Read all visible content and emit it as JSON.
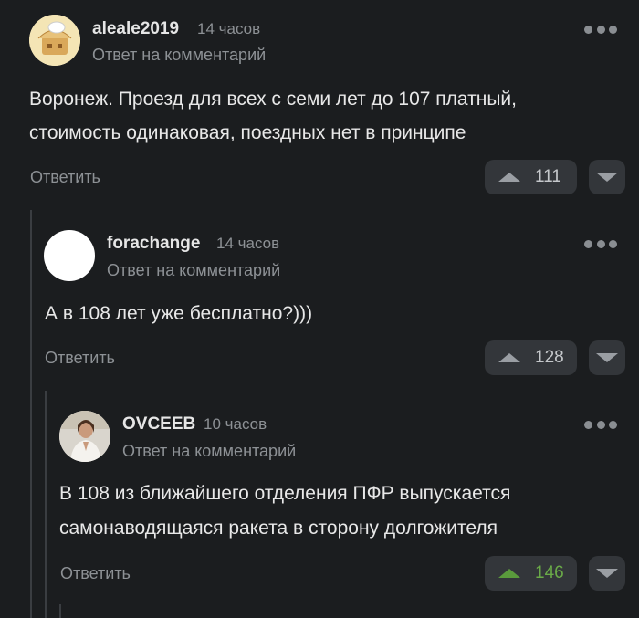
{
  "comments": [
    {
      "username": "aleale2019",
      "time": "14 часов",
      "subtitle": "Ответ на комментарий",
      "body": [
        "Воронеж. Проезд для всех с семи лет до 107 платный,",
        "стоимость одинаковая, поездных нет в принципе"
      ],
      "reply_label": "Ответить",
      "votes": "111",
      "avatar": "cartoon-house-avatar"
    },
    {
      "username": "forachange",
      "time": "14 часов",
      "subtitle": "Ответ на комментарий",
      "body": [
        "А в 108 лет уже бесплатно?)))"
      ],
      "reply_label": "Ответить",
      "votes": "128",
      "avatar": "white-circle-avatar"
    },
    {
      "username": "OVCEEB",
      "time": "10 часов",
      "subtitle": "Ответ на комментарий",
      "body": [
        "В 108 из ближайшего отделения ПФР выпускается",
        "самонаводящаяся ракета в сторону долгожителя"
      ],
      "reply_label": "Ответить",
      "votes": "146",
      "votes_color": "#6aaa48",
      "avatar": "person-photo-avatar"
    }
  ]
}
